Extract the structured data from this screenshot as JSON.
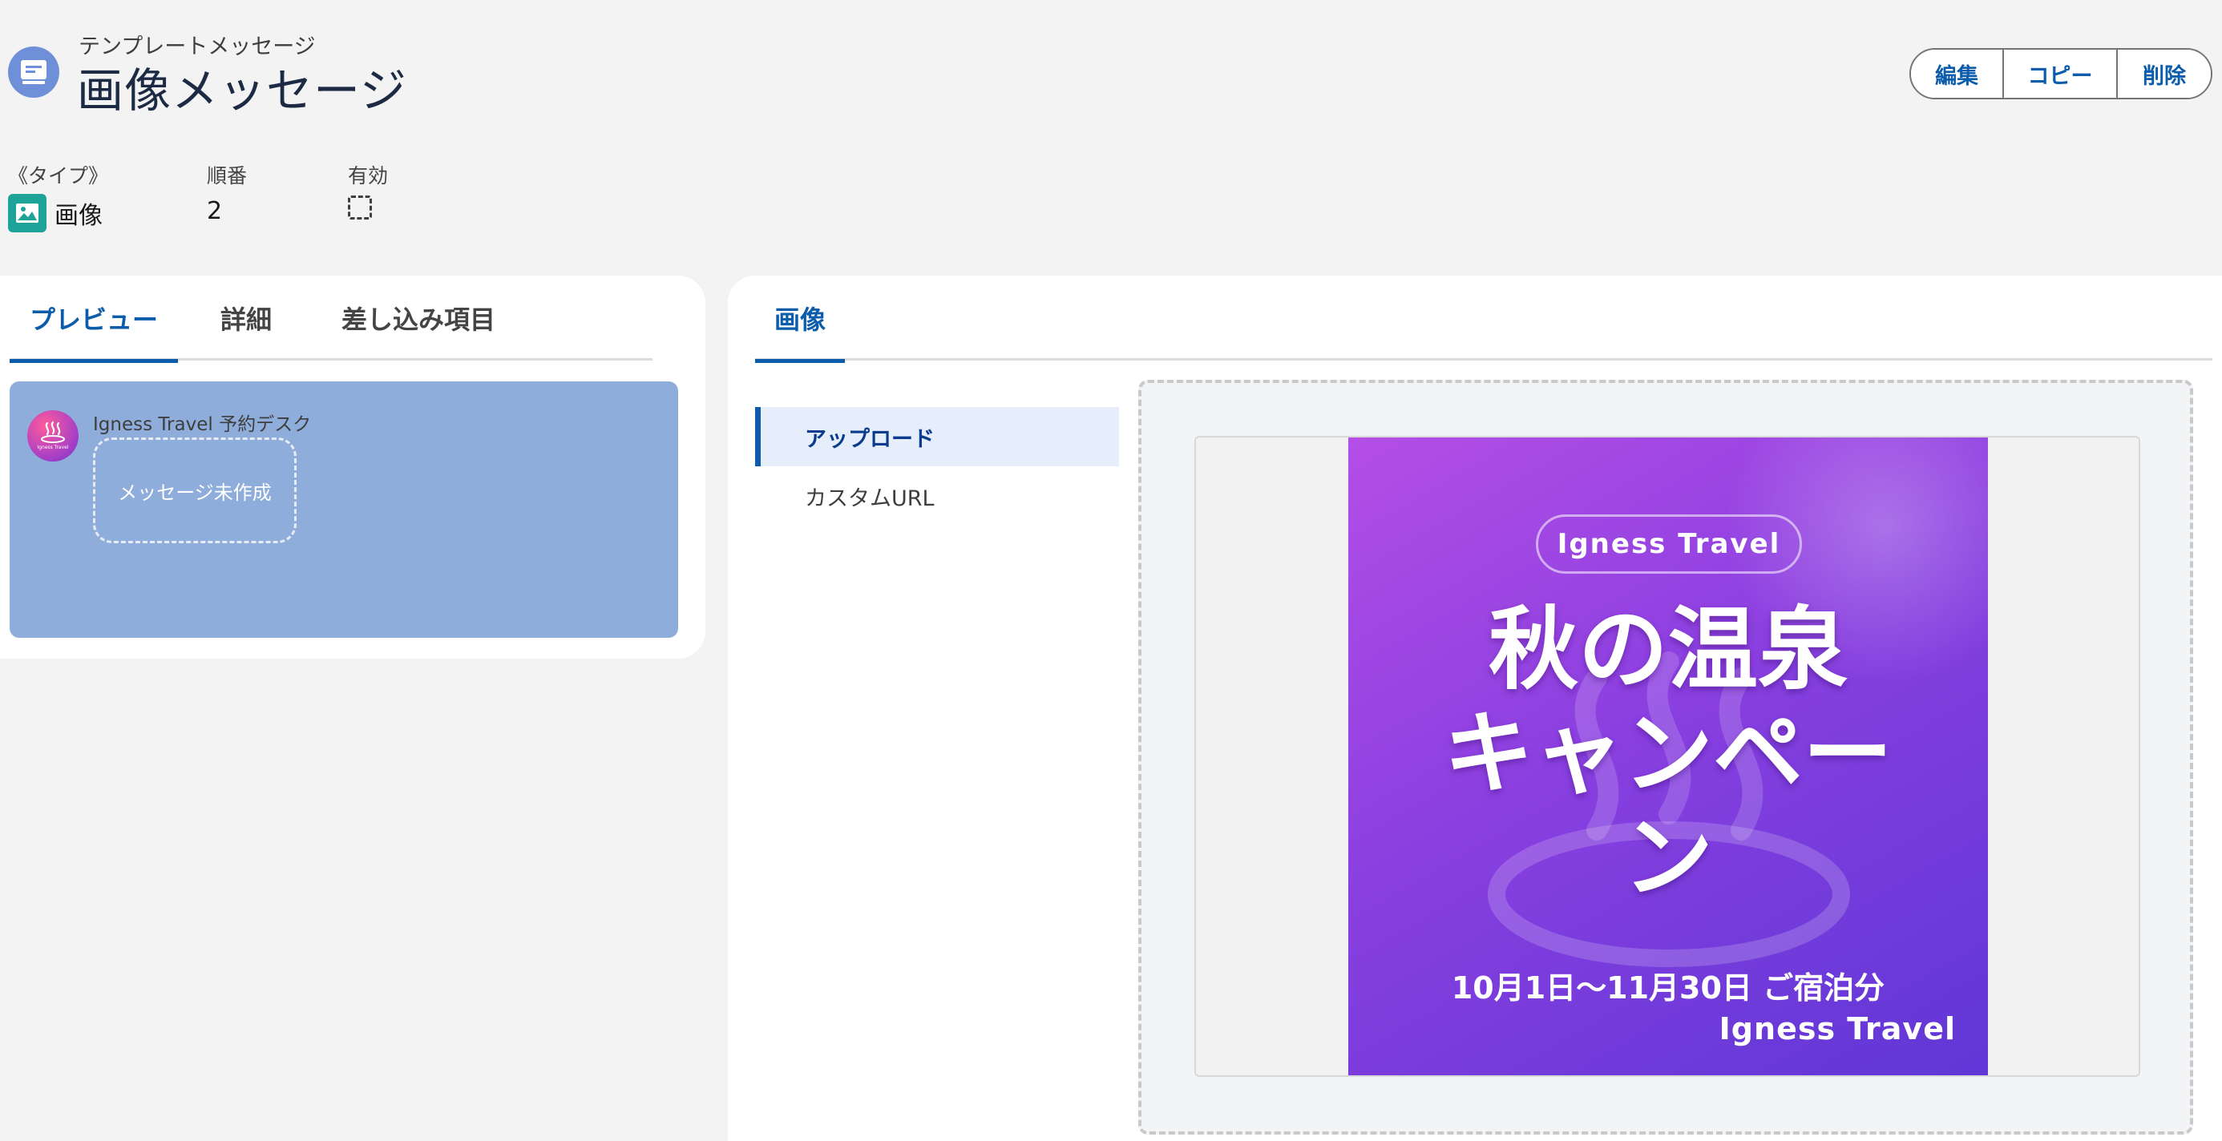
{
  "header": {
    "object_label": "テンプレートメッセージ",
    "title": "画像メッセージ",
    "icon": "template-message-icon",
    "actions": {
      "edit": "編集",
      "copy": "コピー",
      "delete": "削除"
    }
  },
  "highlights": {
    "type_label": "《タイプ》",
    "type_value": "画像",
    "type_icon": "image-icon",
    "order_label": "順番",
    "order_value": "2",
    "active_label": "有効",
    "active_checked": false
  },
  "left_tabs": {
    "preview": "プレビュー",
    "detail": "詳細",
    "merge_fields": "差し込み項目",
    "active": "preview"
  },
  "preview": {
    "sender_name": "Igness Travel 予約デスク",
    "avatar_text": "Igness Travel",
    "empty_message": "メッセージ未作成",
    "background": "#8eaddb"
  },
  "right_tabs": {
    "image": "画像",
    "active": "image"
  },
  "image_source": {
    "options": [
      "アップロード",
      "カスタムURL"
    ],
    "selected": "アップロード"
  },
  "banner": {
    "pill": "Igness Travel",
    "title_line1": "秋の温泉",
    "title_line2": "キャンペー",
    "title_line3": "ン",
    "period": "10月1日〜11月30日 ご宿泊分",
    "brand": "Igness Travel",
    "gradient": [
      "#b44ee6",
      "#5f37d6"
    ]
  },
  "colors": {
    "accent": "#0b5cab",
    "header_icon": "#6f8fd8",
    "type_icon": "#1ea398"
  }
}
